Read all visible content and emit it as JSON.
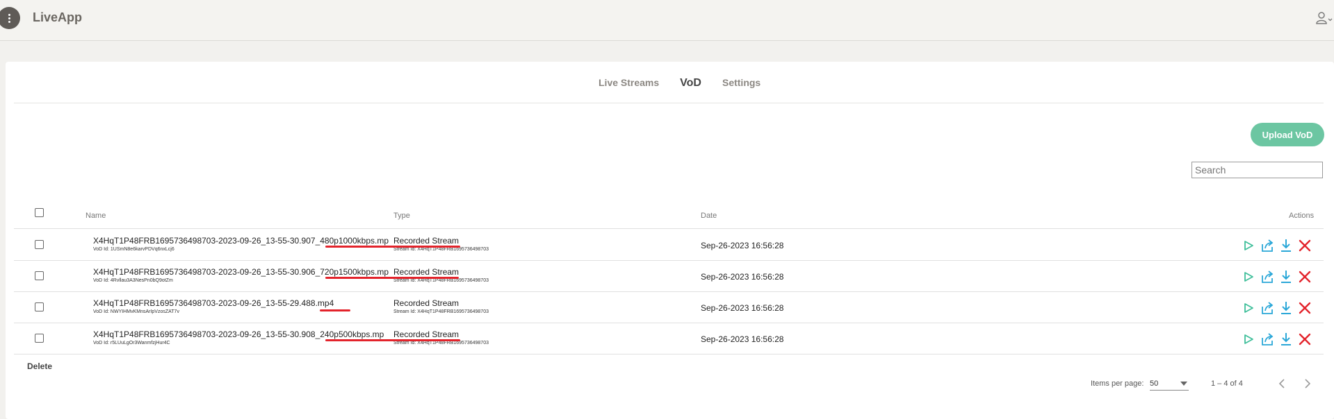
{
  "app": {
    "title": "LiveApp"
  },
  "tabs": [
    {
      "label": "Live Streams",
      "active": false
    },
    {
      "label": "VoD",
      "active": true
    },
    {
      "label": "Settings",
      "active": false
    }
  ],
  "toolbar": {
    "upload_label": "Upload VoD",
    "search_placeholder": "Search"
  },
  "table": {
    "headers": {
      "name": "Name",
      "type": "Type",
      "date": "Date",
      "actions": "Actions"
    },
    "rows": [
      {
        "name_prefix": "X4HqT1P48FRB1695736498703-2023-09-26_13-55-30.907",
        "name_suffix": "_480p1000kbps.mp",
        "vod_id": "VoD Id: 1USmN8e6karvPDVq6nxLcj6",
        "type": "Recorded Stream",
        "stream_id": "Stream Id: X4HqT1P48FRB1695736498703",
        "date": "Sep-26-2023 16:56:28"
      },
      {
        "name_prefix": "X4HqT1P48FRB1695736498703-2023-09-26_13-55-30.906",
        "name_suffix": "_720p1500kbps.mp",
        "vod_id": "VoD Id: 4Rvllau3A3NesPn0bQ9otZm",
        "type": "Recorded Stream",
        "stream_id": "Stream Id: X4HqT1P48FRB1695736498703",
        "date": "Sep-26-2023 16:56:28"
      },
      {
        "name_prefix": "X4HqT1P48FRB1695736498703-2023-09-26_13-55-29.488",
        "name_suffix": ".mp4",
        "vod_id": "VoD Id: NWYIHMvKMnsArIpVzosZAT7v",
        "type": "Recorded Stream",
        "stream_id": "Stream Id: X4HqT1P48FRB1695736498703",
        "date": "Sep-26-2023 16:56:28"
      },
      {
        "name_prefix": "X4HqT1P48FRB1695736498703-2023-09-26_13-55-30.908",
        "name_suffix": "_240p500kbps.mp",
        "vod_id": "VoD Id: r5LUuLgOr3WanmfzjHur4C",
        "type": "Recorded Stream",
        "stream_id": "Stream Id: X4HqT1P48FRB1695736498703",
        "date": "Sep-26-2023 16:56:28"
      }
    ]
  },
  "footer": {
    "delete_label": "Delete",
    "items_per_page_label": "Items per page:",
    "items_per_page_value": "50",
    "range_label": "1 – 4 of 4"
  },
  "icons": {
    "menu": "vertical-dots-icon",
    "user": "user-icon",
    "play": "play-icon",
    "share": "share-icon",
    "download": "download-icon",
    "delete": "close-icon",
    "prev": "chevron-left-icon",
    "next": "chevron-right-icon"
  },
  "colors": {
    "accent": "#6cc6a2",
    "action_blue": "#2aa7d8",
    "delete_red": "#e3232b",
    "annotation_red": "#e3232b"
  }
}
